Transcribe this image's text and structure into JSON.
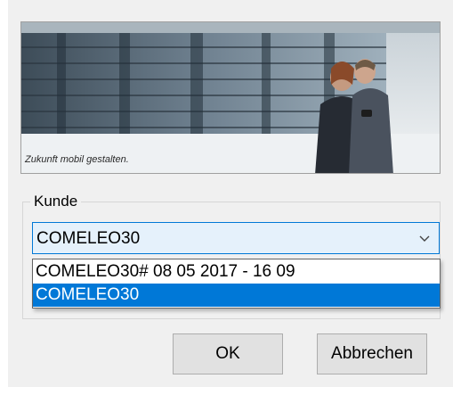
{
  "banner": {
    "caption": "Zukunft mobil gestalten."
  },
  "customer_group": {
    "label": "Kunde",
    "combo": {
      "selected_value": "COMELEO30"
    },
    "dropdown_options": [
      {
        "label": "COMELEO30# 08 05 2017 - 16 09",
        "highlighted": false
      },
      {
        "label": "COMELEO30",
        "highlighted": true
      }
    ]
  },
  "buttons": {
    "ok_label": "OK",
    "cancel_label": "Abbrechen"
  },
  "icons": {
    "combo_arrow": "chevron-down-icon"
  },
  "colors": {
    "selection": "#0078d7",
    "dialog_bg": "#f0f0f0",
    "combo_focus_bg": "#e5f1fb"
  }
}
